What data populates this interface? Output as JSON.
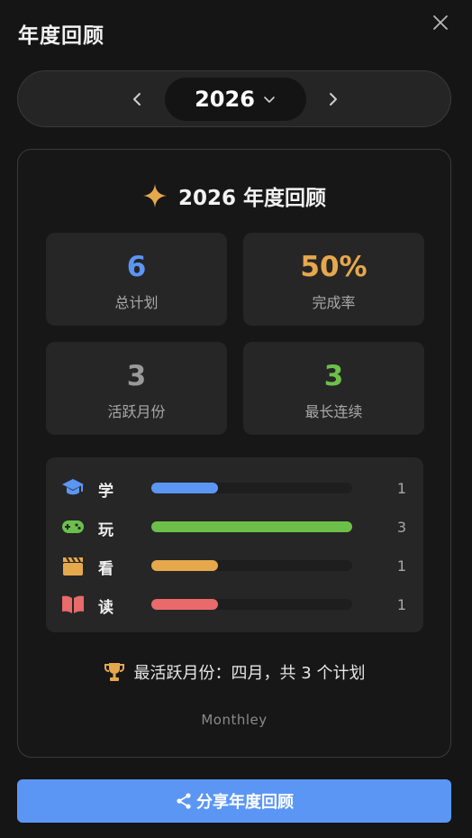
{
  "header": {
    "title": "年度回顾",
    "close_icon": "close-icon"
  },
  "year_nav": {
    "year": "2026",
    "prev_icon": "chevron-left-icon",
    "next_icon": "chevron-right-icon",
    "dropdown_icon": "chevron-down-icon"
  },
  "card": {
    "title": "2026 年度回顾",
    "title_icon": "sparkle-icon",
    "stats": [
      {
        "value": "6",
        "label": "总计划",
        "color": "#5b96f5"
      },
      {
        "value": "50%",
        "label": "完成率",
        "color": "#e6a84d"
      },
      {
        "value": "3",
        "label": "活跃月份",
        "color": "#9a9a9a"
      },
      {
        "value": "3",
        "label": "最长连续",
        "color": "#6cc04a"
      }
    ],
    "categories": [
      {
        "label": "学",
        "count": "1",
        "fraction": 0.3333,
        "color": "#5b96f5",
        "icon": "graduation-cap-icon"
      },
      {
        "label": "玩",
        "count": "3",
        "fraction": 1.0,
        "color": "#6cc04a",
        "icon": "gamepad-icon"
      },
      {
        "label": "看",
        "count": "1",
        "fraction": 0.3333,
        "color": "#e6a84d",
        "icon": "clapperboard-icon"
      },
      {
        "label": "读",
        "count": "1",
        "fraction": 0.3333,
        "color": "#e86a6a",
        "icon": "open-book-icon"
      }
    ],
    "active_month_text": "最活跃月份：四月，共 3 个计划",
    "active_month_icon": "trophy-icon",
    "brand": "Monthley"
  },
  "share": {
    "label": "分享年度回顾",
    "icon": "share-icon"
  }
}
